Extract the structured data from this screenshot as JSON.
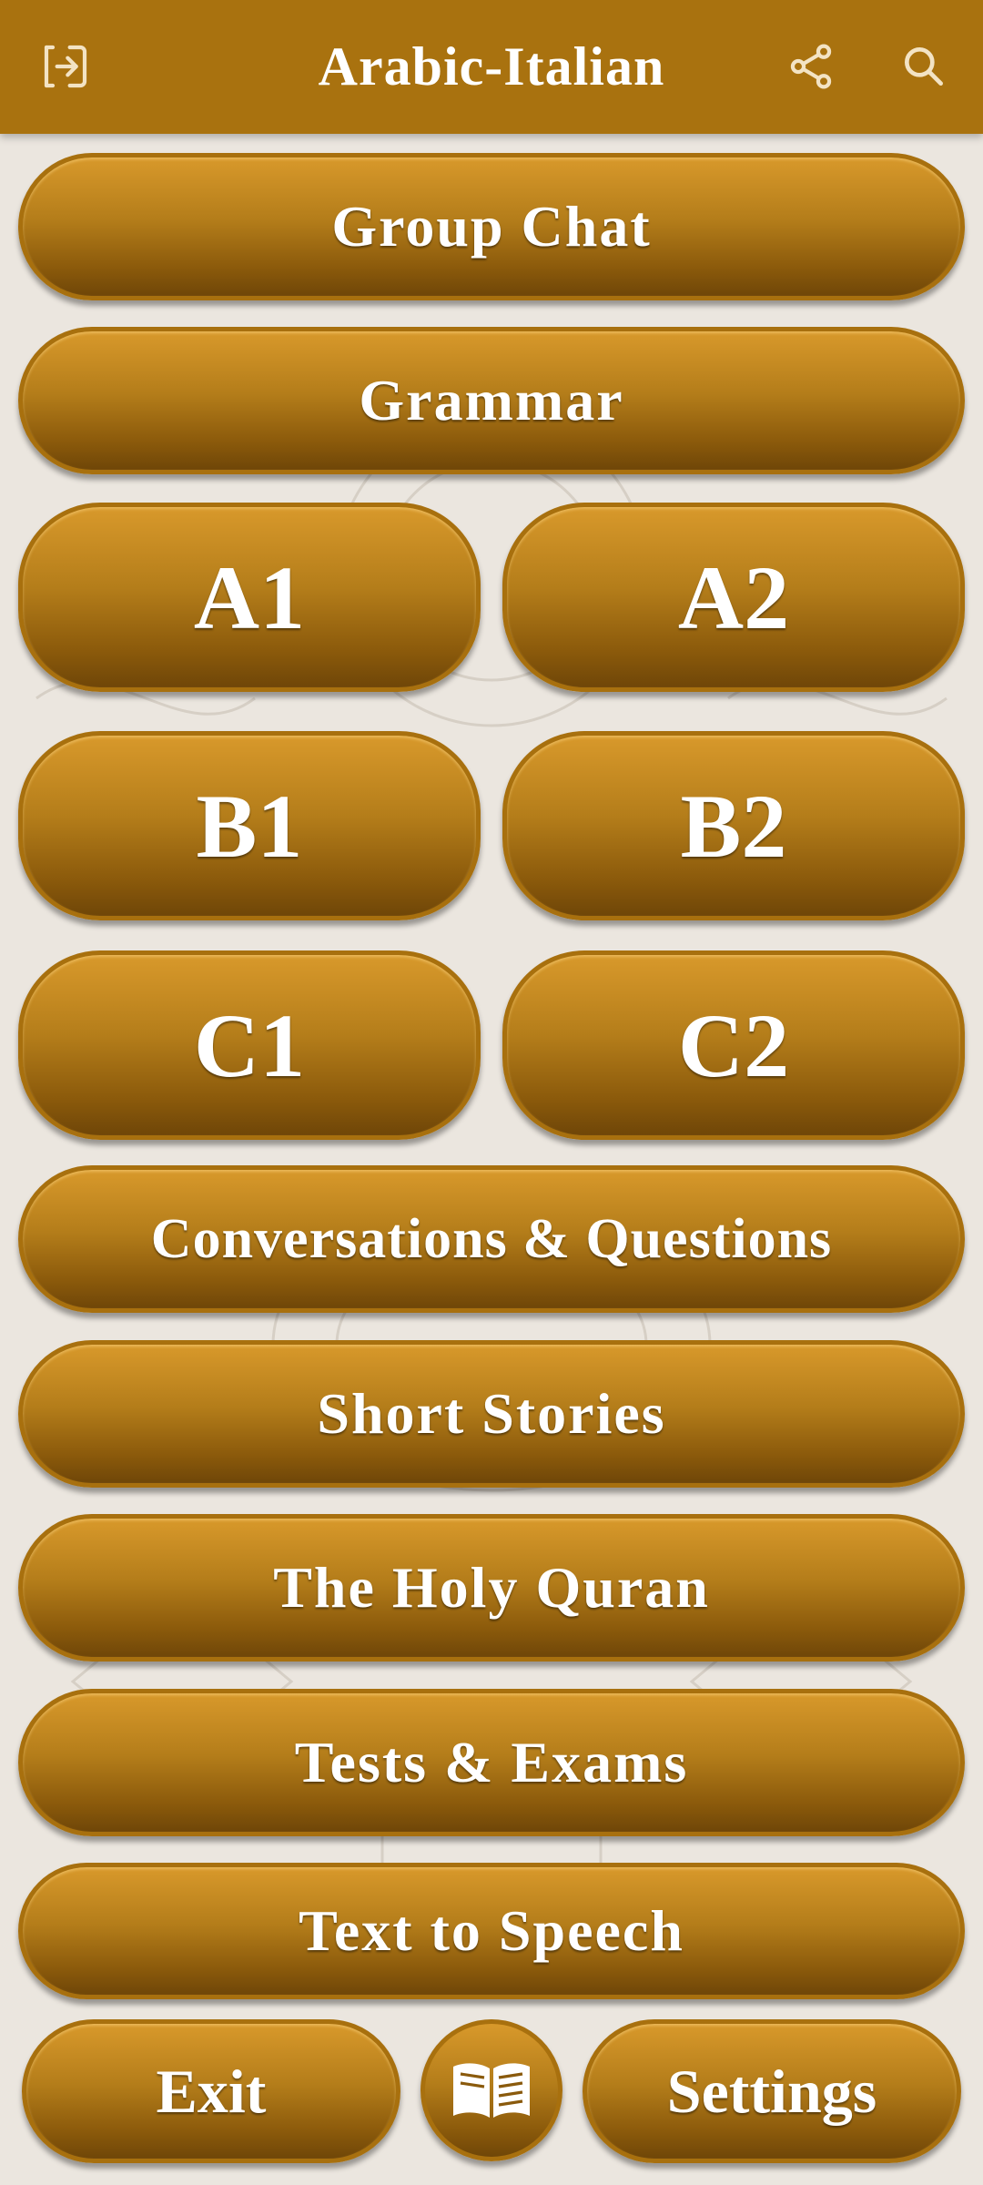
{
  "app_bar": {
    "title": "Arabic-Italian",
    "icons": [
      "login-icon",
      "share-icon",
      "search-icon"
    ]
  },
  "menu": {
    "group_chat": "Group Chat",
    "grammar": "Grammar",
    "levels": [
      "A1",
      "A2",
      "B1",
      "B2",
      "C1",
      "C2"
    ],
    "conversations": "Conversations & Questions",
    "short_stories": "Short Stories",
    "holy_quran": "The Holy Quran",
    "tests": "Tests & Exams",
    "tts": "Text to Speech"
  },
  "bottom": {
    "exit": "Exit",
    "settings": "Settings",
    "center_icon": "book-icon"
  },
  "colors": {
    "app_bar": "#a9720f",
    "button_top": "#d8992b",
    "button_bottom": "#6f4608",
    "background": "#ebe6df"
  }
}
